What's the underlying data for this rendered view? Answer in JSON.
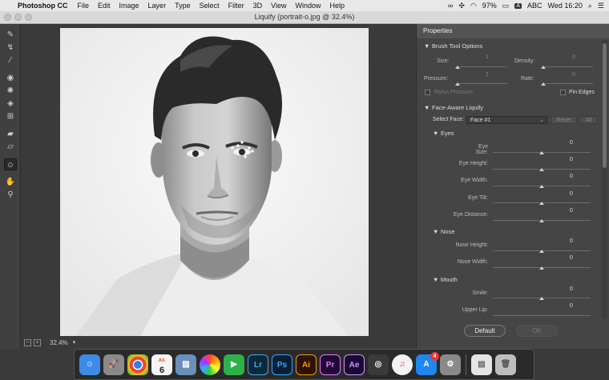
{
  "menubar": {
    "app_name": "Photoshop CC",
    "menus": [
      "File",
      "Edit",
      "Image",
      "Layer",
      "Type",
      "Select",
      "Filter",
      "3D",
      "View",
      "Window",
      "Help"
    ],
    "battery": "97%",
    "input_source": "ABC",
    "input_badge": "A",
    "clock": "Wed 16:20",
    "status_icons": [
      "creative-cloud-icon",
      "extension-icon",
      "wifi-icon",
      "battery-icon",
      "keyboard-input-icon",
      "search-icon",
      "menu-list-icon"
    ]
  },
  "window": {
    "title": "Liquify (portrait-o.jpg @ 32.4%)"
  },
  "canvas": {
    "zoom": "32.4%",
    "zoom_minus": "−",
    "zoom_plus": "+"
  },
  "panel": {
    "title": "Properties",
    "brush": {
      "title": "Brush Tool Options",
      "size_label": "Size:",
      "size_value": "1",
      "density_label": "Density:",
      "density_value": "0",
      "pressure_label": "Pressure:",
      "pressure_value": "1",
      "rate_label": "Rate:",
      "rate_value": "0",
      "stylus_label": "Stylus Pressure",
      "pin_edges_label": "Pin Edges"
    },
    "face": {
      "title": "Face-Aware Liquify",
      "select_label": "Select Face:",
      "select_value": "Face #1",
      "reset_label": "Reset",
      "all_label": "All",
      "eyes": {
        "title": "Eyes",
        "rows": [
          {
            "label": "Eye Size:",
            "value": "0"
          },
          {
            "label": "Eye Height:",
            "value": "0"
          },
          {
            "label": "Eye Width:",
            "value": "0"
          },
          {
            "label": "Eye Tilt:",
            "value": "0"
          },
          {
            "label": "Eye Distance:",
            "value": "0"
          }
        ]
      },
      "nose": {
        "title": "Nose",
        "rows": [
          {
            "label": "Nose Height:",
            "value": "0"
          },
          {
            "label": "Nose Width:",
            "value": "0"
          }
        ]
      },
      "mouth": {
        "title": "Mouth",
        "rows": [
          {
            "label": "Smile:",
            "value": "0"
          },
          {
            "label": "Upper Lip:",
            "value": "0"
          }
        ]
      }
    },
    "default_label": "Default",
    "ok_label": "OK"
  },
  "dock": {
    "calendar_month": "JUL",
    "calendar_day": "6",
    "appstore_badge": "4",
    "apps": [
      {
        "name": "finder-icon",
        "label": "",
        "color": "#3d8ae8"
      },
      {
        "name": "launchpad-icon",
        "label": "",
        "color": "#8a8a8a"
      },
      {
        "name": "chrome-icon",
        "label": "",
        "color": "#e8e8e8"
      },
      {
        "name": "calendar-icon",
        "label": "",
        "color": "#f4f4f4"
      },
      {
        "name": "preview-icon",
        "label": "",
        "color": "#6a8fb8"
      },
      {
        "name": "photos-icon",
        "label": "",
        "color": "#f0f0f0"
      },
      {
        "name": "facetime-icon",
        "label": "",
        "color": "#2fb14a"
      },
      {
        "name": "lightroom-icon",
        "label": "Lr",
        "color": "#0d2a3a"
      },
      {
        "name": "photoshop-icon",
        "label": "Ps",
        "color": "#0a1f33"
      },
      {
        "name": "illustrator-icon",
        "label": "Ai",
        "color": "#2b1400"
      },
      {
        "name": "premiere-icon",
        "label": "Pr",
        "color": "#1f0a33"
      },
      {
        "name": "after-effects-icon",
        "label": "Ae",
        "color": "#1a0a33"
      },
      {
        "name": "dvd-player-icon",
        "label": "",
        "color": "#3a3a3a"
      },
      {
        "name": "itunes-icon",
        "label": "",
        "color": "#f2f2f2"
      },
      {
        "name": "app-store-icon",
        "label": "",
        "color": "#1e88f0"
      },
      {
        "name": "system-preferences-icon",
        "label": "",
        "color": "#8a8a8a"
      },
      {
        "name": "document-icon",
        "label": "",
        "color": "#e4e4e4"
      },
      {
        "name": "trash-icon",
        "label": "",
        "color": "#bdbdbd"
      }
    ]
  }
}
